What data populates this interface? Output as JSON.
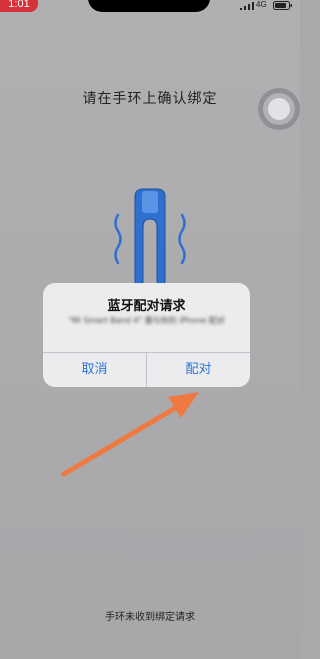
{
  "status_bar": {
    "time": "1:01",
    "network": "4G",
    "accent_color": "#d6323a"
  },
  "page": {
    "title": "请在手环上确认绑定",
    "bottom_link": "手环未收到绑定请求"
  },
  "dialog": {
    "title": "蓝牙配对请求",
    "message": "\"Mi Smart Band 4\" 要与你的 iPhone 配对",
    "cancel_label": "取消",
    "pair_label": "配对",
    "button_color": "#2b73d9"
  },
  "icons": {
    "assistive": "assistive-touch-icon",
    "band": "smart-band-icon",
    "arrow": "annotation-arrow-icon"
  }
}
